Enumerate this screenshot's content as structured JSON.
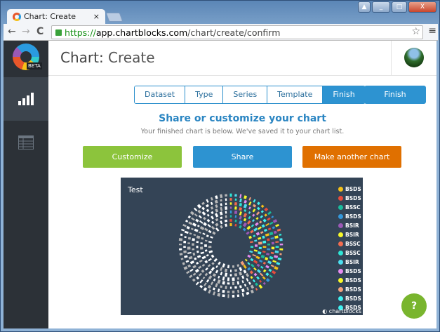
{
  "browser": {
    "tab_title": "Chart: Create",
    "url_scheme": "https://",
    "url_domain": "app.chartblocks.com",
    "url_path": "/chart/create/confirm"
  },
  "sidebar": {
    "badge": "BETA",
    "items": [
      {
        "icon": "bar-chart-icon",
        "active": true
      },
      {
        "icon": "table-icon",
        "active": false
      }
    ]
  },
  "header": {
    "title_prefix": "Chart:",
    "title_rest": " Create"
  },
  "steps": [
    "Dataset",
    "Type",
    "Series",
    "Template",
    "Finish"
  ],
  "finish_label": "Finish",
  "heading": "Share or customize your chart",
  "subheading": "Your finished chart is below. We've saved it to your chart list.",
  "actions": {
    "customize": "Customize",
    "share": "Share",
    "another": "Make another chart"
  },
  "colors": {
    "customize": "#8cc43c",
    "share": "#2d93d1",
    "another": "#e07000",
    "chart_bg": "#344456"
  },
  "chart_data": {
    "type": "radial",
    "title": "Test",
    "legend_placement": "right",
    "legend": [
      {
        "name": "BSDS",
        "color": "#f5c018"
      },
      {
        "name": "BSDS",
        "color": "#e74c3c"
      },
      {
        "name": "BSSC",
        "color": "#1abc9c"
      },
      {
        "name": "BSDS",
        "color": "#3498db"
      },
      {
        "name": "BSIR",
        "color": "#9b59b6"
      },
      {
        "name": "BSIR",
        "color": "#f7f72a"
      },
      {
        "name": "BSSC",
        "color": "#f26c4f"
      },
      {
        "name": "BSSC",
        "color": "#2ee6d6"
      },
      {
        "name": "BSIR",
        "color": "#4de0f0"
      },
      {
        "name": "BSDS",
        "color": "#e68cf0"
      },
      {
        "name": "BSDS",
        "color": "#f7f72a"
      },
      {
        "name": "BSDS",
        "color": "#f2a07b"
      },
      {
        "name": "BSDS",
        "color": "#40f0f0"
      },
      {
        "name": "BSDS",
        "color": "#40f0f0"
      }
    ],
    "watermark": "chartblocks"
  }
}
